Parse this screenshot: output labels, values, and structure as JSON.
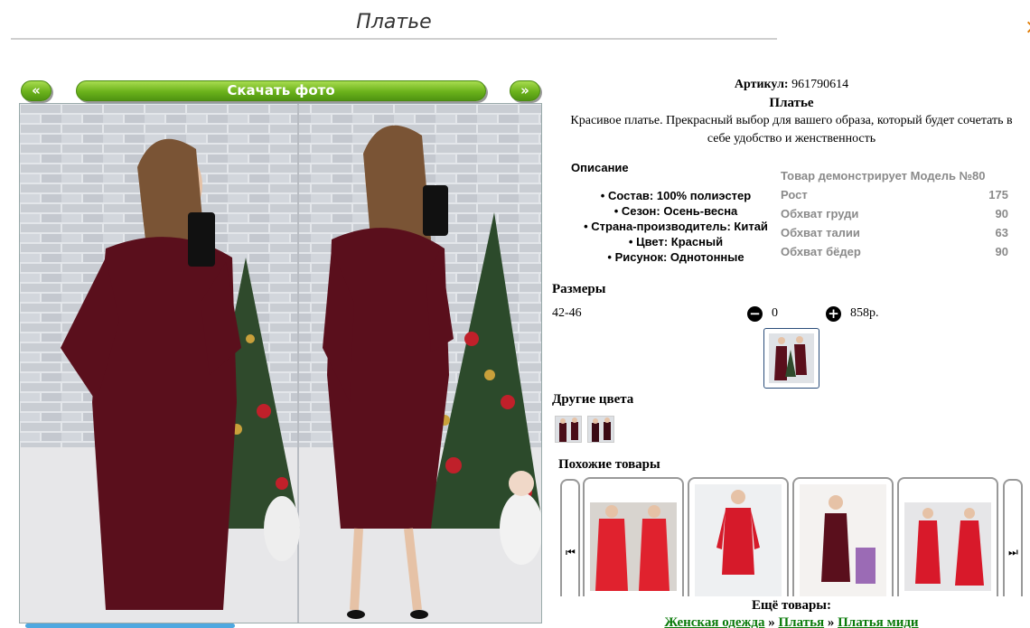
{
  "header": {
    "title": "Платье",
    "close_glyph": "×"
  },
  "gallery": {
    "prev_label": "«",
    "next_label": "»",
    "download_label": "Скачать фото"
  },
  "product": {
    "article_label": "Артикул:",
    "article_value": "961790614",
    "name": "Платье",
    "description": "Красивое платье. Прекрасный выбор для вашего образа, который будет сочетать в себе удобство и женственность"
  },
  "details": {
    "title": "Описание",
    "items": [
      "Состав: 100% полиэстер",
      "Сезон: Осень-весна",
      "Страна-производитель: Китай",
      "Цвет: Красный",
      "Рисунок: Однотонные"
    ]
  },
  "model": {
    "heading": "Товар демонстрирует Модель №80",
    "rows": [
      {
        "label": "Рост",
        "value": "175"
      },
      {
        "label": "Обхват груди",
        "value": "90"
      },
      {
        "label": "Обхват талии",
        "value": "63"
      },
      {
        "label": "Обхват бёдер",
        "value": "90"
      }
    ]
  },
  "sizes": {
    "title": "Размеры",
    "rows": [
      {
        "size": "42-46",
        "minus": "−",
        "qty": "0",
        "plus": "+",
        "price": "858р."
      }
    ]
  },
  "colors": {
    "title": "Другие цвета"
  },
  "similar": {
    "title": "Похожие товары",
    "prev_glyph": "⏮",
    "next_glyph": "⏭"
  },
  "more": {
    "title": "Ещё товары:",
    "breadcrumb": [
      "Женская одежда",
      "Платья",
      "Платья миди"
    ],
    "separator": "»"
  },
  "colors_palette": {
    "button_green": "#6bb21b",
    "dress_burgundy": "#5a0f1c",
    "link_green": "#0a7a0a",
    "muted_text": "#8a8a8a"
  }
}
